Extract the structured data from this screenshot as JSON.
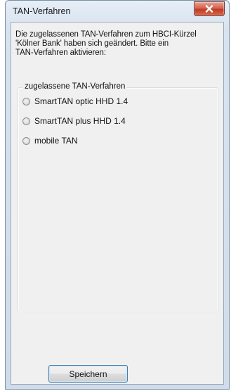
{
  "window": {
    "title": "TAN-Verfahren"
  },
  "dialog": {
    "message": "Die zugelassenen TAN-Verfahren zum HBCI-Kürzel\n'Kölner Bank' haben sich geändert. Bitte ein\nTAN-Verfahren aktivieren:",
    "group_label": "zugelassene TAN-Verfahren",
    "options": [
      {
        "label": "SmartTAN optic HHD 1.4",
        "selected": false
      },
      {
        "label": "SmartTAN plus HHD 1.4",
        "selected": false
      },
      {
        "label": "mobile TAN",
        "selected": false
      }
    ],
    "save_label": "Speichern"
  },
  "icons": {
    "close": "close-icon"
  }
}
